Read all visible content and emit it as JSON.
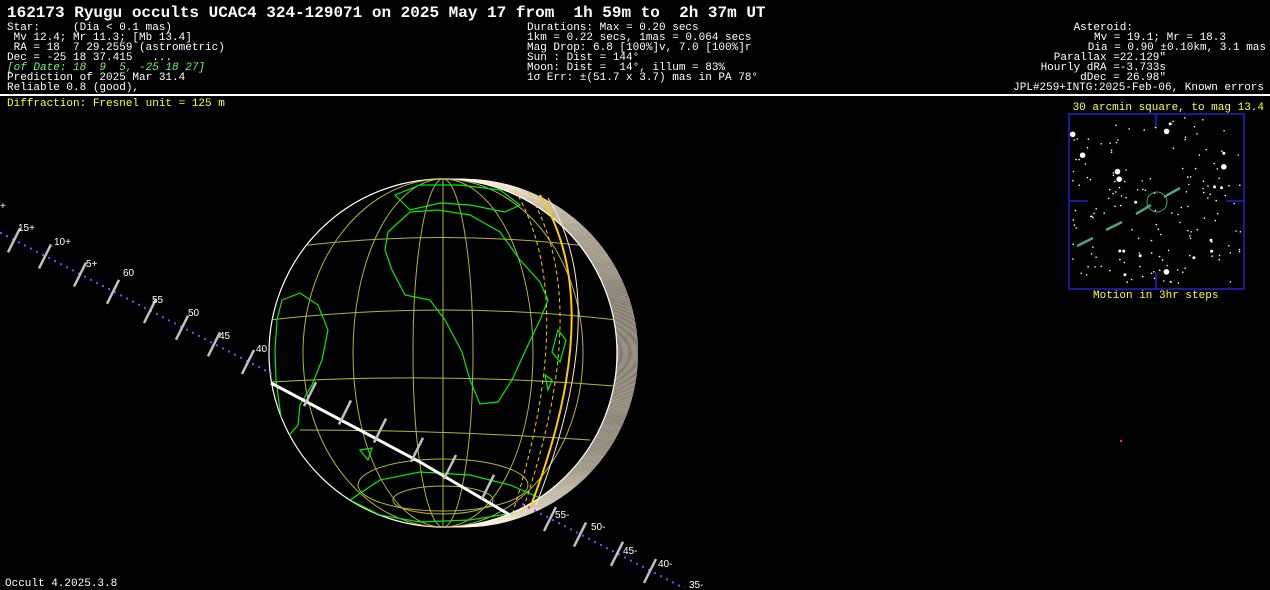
{
  "title": "162173 Ryugu occults UCAC4 324-129071 on 2025 May 17 from  1h 59m to  2h 37m UT",
  "star": {
    "lines": [
      "Star:     (Dia < 0.1 mas)",
      " Mv 12.4; Mr 11.3; [Mb 13.4]",
      " RA = 18  7 29.2559 (astrometric)",
      "Dec = -25 18 37.415   ...",
      "[of Date: 18  9  5, -25 18 27]",
      "Prediction of 2025 Mar 31.4",
      "Reliable 0.8 (good),"
    ]
  },
  "event": {
    "lines": [
      "Durations: Max = 0.20 secs",
      "1km = 0.22 secs, 1mas = 0.064 secs",
      "Mag Drop: 6.8 [100%]v, 7.0 [100%]r",
      "Sun : Dist = 144°",
      "Moon: Dist =  14°, illum = 83%",
      "1σ Err: ±(51.7 x 3.7) mas in PA 78°"
    ]
  },
  "asteroid": {
    "lines": [
      "Asteroid:",
      "Mv = 19.1; Mr = 18.3",
      "Dia = 0.90 ±0.10km, 3.1 mas",
      "Parallax =22.129\"",
      "Hourly dRA =-3.733s",
      "dDec = 26.98\"",
      "JPL#259+INTG:2025-Feb-06, Known errors"
    ]
  },
  "diffraction": "Diffraction: Fresnel unit = 125 m",
  "finder": {
    "title": "30 arcmin square, to mag 13.4",
    "caption": "Motion in 3hr steps"
  },
  "footer": "Occult 4.2025.3.8",
  "track_labels": [
    "+",
    "15+",
    "10+",
    "5+",
    "60",
    "55",
    "50",
    "45",
    "40",
    "55-",
    "50-",
    "45-",
    "40-",
    "35-"
  ],
  "colors": {
    "background": "#000000",
    "title_text": "#ffffff",
    "highlight_text": "#ffff33",
    "of_date_text": "#66ff66",
    "coastline": "#00ee00",
    "graticule": "#b4b43c",
    "limb_arcs": "#fff2dc",
    "terminator": "#ffcc00",
    "ground_track": "#ffffff",
    "time_ticks": "#c0c0c0",
    "track_dots": "#9933ff",
    "finder_frame": "#2222cc",
    "finder_motion": "#44aa77"
  },
  "icons": [
    "ground-track",
    "earth-globe",
    "star-chart"
  ]
}
